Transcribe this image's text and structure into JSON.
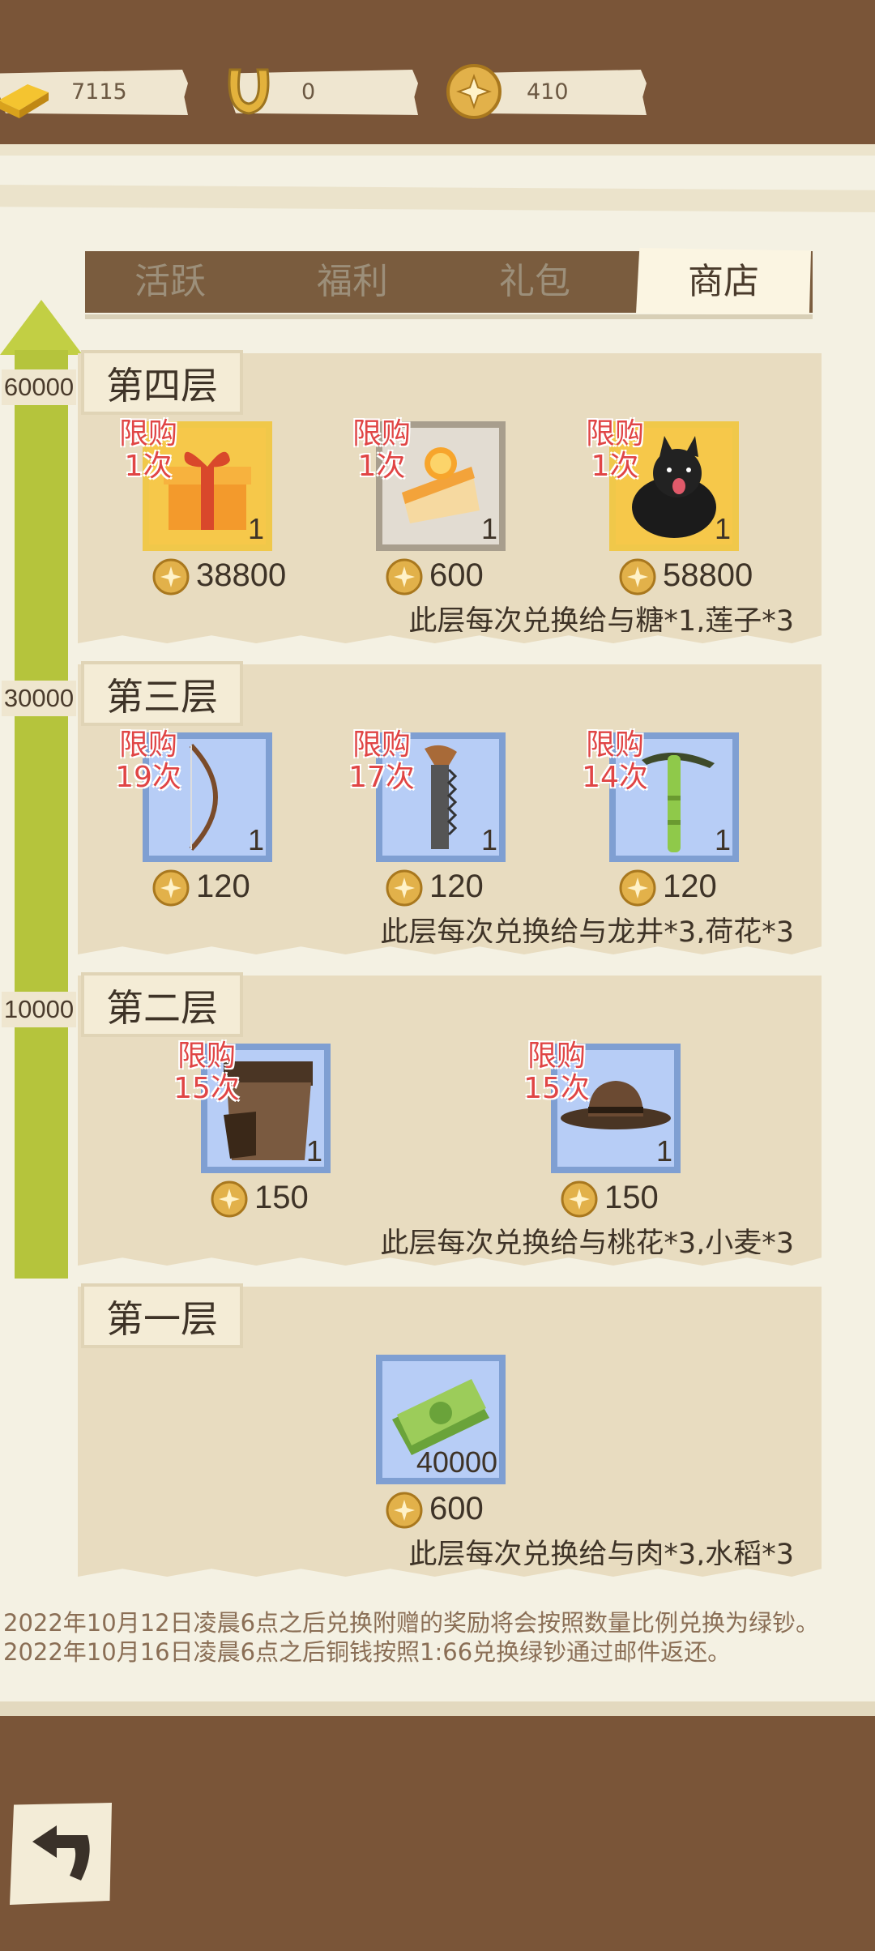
{
  "currencies": [
    {
      "name": "gold-bar-icon",
      "value": "7115"
    },
    {
      "name": "horseshoe-icon",
      "value": "0"
    },
    {
      "name": "copper-coin-icon",
      "value": "410"
    }
  ],
  "tabs": [
    {
      "label": "活跃",
      "active": false
    },
    {
      "label": "福利",
      "active": false
    },
    {
      "label": "礼包",
      "active": false
    },
    {
      "label": "商店",
      "active": true
    }
  ],
  "progress": {
    "markers": [
      "60000",
      "30000",
      "10000"
    ]
  },
  "floors": [
    {
      "title": "第四层",
      "note": "此层每次兑换给与糖*1,莲子*3",
      "items": [
        {
          "icon": "gift-box-icon",
          "limit1": "限购",
          "limit2": "1次",
          "qty": "1",
          "price": "38800",
          "frame": "gold"
        },
        {
          "icon": "orange-cake-icon",
          "limit1": "限购",
          "limit2": "1次",
          "qty": "1",
          "price": "600",
          "frame": "gray"
        },
        {
          "icon": "black-dog-icon",
          "limit1": "限购",
          "limit2": "1次",
          "qty": "1",
          "price": "58800",
          "frame": "gold"
        }
      ]
    },
    {
      "title": "第三层",
      "note": "此层每次兑换给与龙井*3,荷花*3",
      "items": [
        {
          "icon": "bow-icon",
          "limit1": "限购",
          "limit2": "19次",
          "qty": "1",
          "price": "120",
          "frame": "blue"
        },
        {
          "icon": "saw-icon",
          "limit1": "限购",
          "limit2": "17次",
          "qty": "1",
          "price": "120",
          "frame": "blue"
        },
        {
          "icon": "pickaxe-icon",
          "limit1": "限购",
          "limit2": "14次",
          "qty": "1",
          "price": "120",
          "frame": "blue"
        }
      ]
    },
    {
      "title": "第二层",
      "note": "此层每次兑换给与桃花*3,小麦*3",
      "items": [
        {
          "icon": "leather-boots-icon",
          "limit1": "限购",
          "limit2": "15次",
          "qty": "1",
          "price": "150",
          "frame": "blue"
        },
        {
          "icon": "brown-hat-icon",
          "limit1": "限购",
          "limit2": "15次",
          "qty": "1",
          "price": "150",
          "frame": "blue"
        }
      ]
    },
    {
      "title": "第一层",
      "note": "此层每次兑换给与肉*3,水稻*3",
      "items": [
        {
          "icon": "green-cash-icon",
          "qty": "40000",
          "price": "600",
          "frame": "blue"
        }
      ]
    }
  ],
  "footnotes": [
    "2022年10月12日凌晨6点之后兑换附赠的奖励将会按照数量比例兑换为绿钞。",
    "2022年10月16日凌晨6点之后铜钱按照1:66兑换绿钞通过邮件返还。"
  ],
  "colors": {
    "background": "#7a5538",
    "paper": "#f4f1e3",
    "limit_red": "#e04545",
    "progress_green": "#b5c43c",
    "gold_frame": "#f0c84a",
    "blue_frame": "#7f9fd2"
  }
}
